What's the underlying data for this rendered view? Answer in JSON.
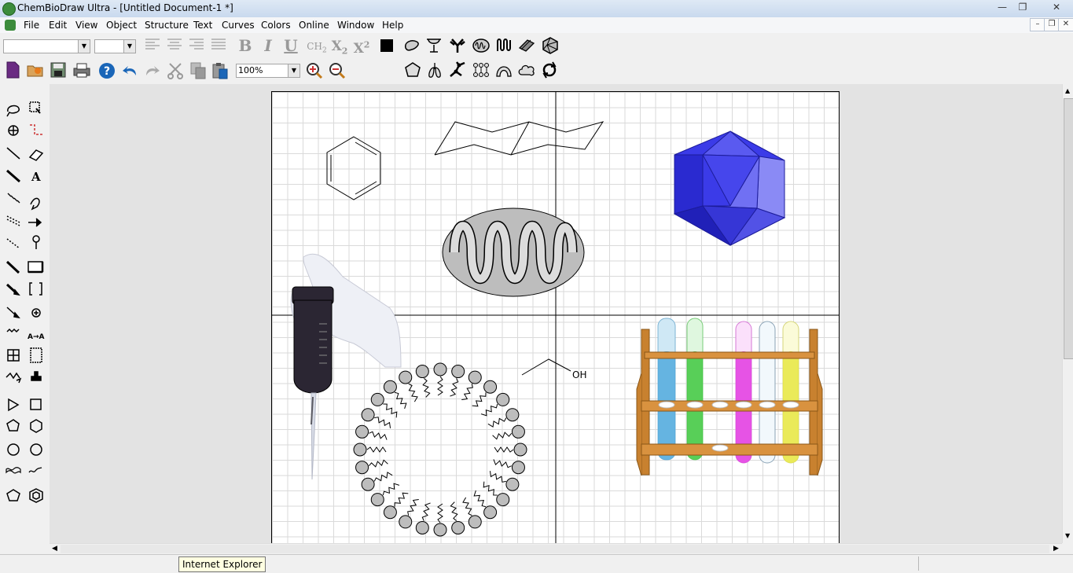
{
  "window": {
    "title": "ChemBioDraw Ultra - [Untitled Document-1 *]"
  },
  "menu": {
    "items": [
      "File",
      "Edit",
      "View",
      "Object",
      "Structure",
      "Text",
      "Curves",
      "Colors",
      "Online",
      "Window",
      "Help"
    ]
  },
  "toolbar": {
    "font_value": "",
    "size_value": "",
    "zoom_value": "100%",
    "bold": "B",
    "italic": "I",
    "underline": "U",
    "formula": "CH2",
    "subscript": "X2",
    "superscript": "X2"
  },
  "canvas": {
    "oh_label": "OH"
  },
  "status": {
    "tooltip": "Internet Explorer"
  },
  "colors": {
    "icosahedron": "#3b3be8",
    "mito_fill": "#bdbdbd",
    "rack_wood": "#d9923f"
  }
}
